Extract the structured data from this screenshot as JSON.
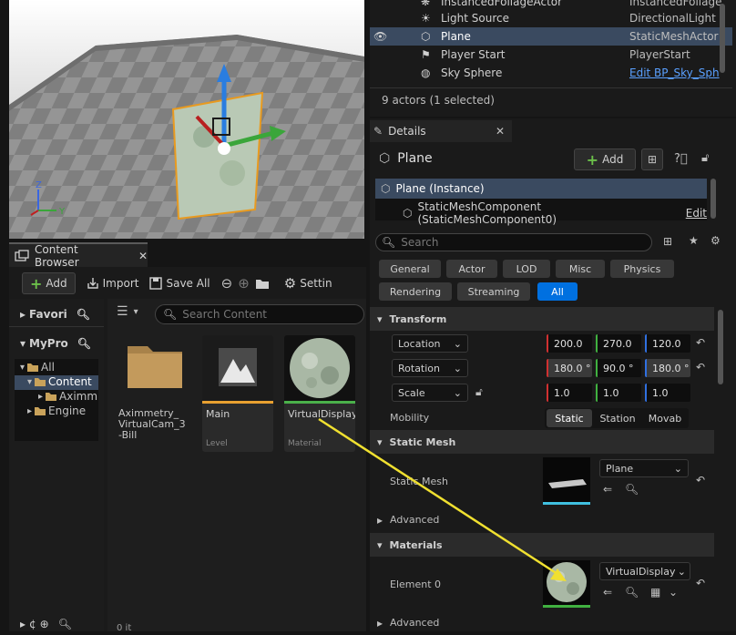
{
  "outliner": {
    "rows": [
      {
        "name": "InstancedFoliageActor",
        "type": "InstancedFoliage"
      },
      {
        "name": "Light Source",
        "type": "DirectionalLight"
      },
      {
        "name": "Plane",
        "type": "StaticMeshActor"
      },
      {
        "name": "Player Start",
        "type": "PlayerStart"
      },
      {
        "name": "Sky Sphere",
        "type": "Edit BP_Sky_Sph"
      }
    ],
    "status": "9 actors (1 selected)"
  },
  "details": {
    "tab_label": "Details",
    "actor_name": "Plane",
    "add_label": "Add",
    "instance_label": "Plane (Instance)",
    "component_label": "StaticMeshComponent (StaticMeshComponent0)",
    "component_edit": "Edit",
    "search_placeholder": "Search",
    "filters": [
      "General",
      "Actor",
      "LOD",
      "Misc",
      "Physics",
      "Rendering",
      "Streaming",
      "All"
    ],
    "transform": {
      "header": "Transform",
      "location_label": "Location",
      "location": [
        "200.0",
        "270.0",
        "120.0"
      ],
      "rotation_label": "Rotation",
      "rotation": [
        "180.0 °",
        "90.0 °",
        "180.0 °"
      ],
      "scale_label": "Scale",
      "scale": [
        "1.0",
        "1.0",
        "1.0"
      ],
      "mobility_label": "Mobility",
      "mobility_options": [
        "Static",
        "Station",
        "Movab"
      ]
    },
    "static_mesh": {
      "header": "Static Mesh",
      "label": "Static Mesh",
      "value": "Plane",
      "advanced": "Advanced"
    },
    "materials": {
      "header": "Materials",
      "element_label": "Element 0",
      "value": "VirtualDisplay",
      "advanced": "Advanced"
    }
  },
  "content_browser": {
    "tab_label": "Content Browser",
    "add_label": "Add",
    "import_label": "Import",
    "save_all_label": "Save All",
    "settings_label": "Settin",
    "search_placeholder": "Search Content",
    "favorites_label": "Favori",
    "project_label": "MyPro",
    "tree": [
      "All",
      "Content",
      "Aximm",
      "Engine"
    ],
    "assets": [
      {
        "name": "Aximmetry_ VirtualCam_3 -Bill",
        "type": ""
      },
      {
        "name": "Main",
        "type": "Level"
      },
      {
        "name": "VirtualDisplay",
        "type": "Material"
      }
    ],
    "bottom_text": "0 it"
  },
  "colors": {
    "accent": "#0070e0",
    "selection": "#3a4a60",
    "arrow": "#f0e030"
  }
}
